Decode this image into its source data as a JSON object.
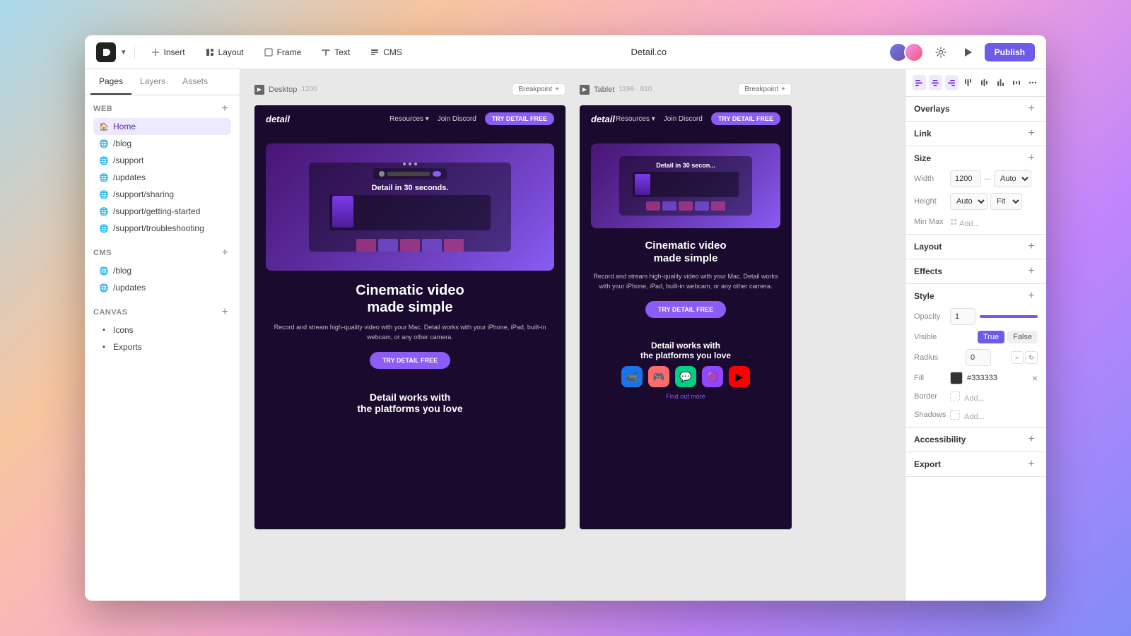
{
  "window": {
    "title": "Detail.co"
  },
  "topbar": {
    "logo": "D",
    "insert_label": "Insert",
    "layout_label": "Layout",
    "frame_label": "Frame",
    "text_label": "Text",
    "cms_label": "CMS",
    "title": "Detail.co",
    "publish_label": "Publish"
  },
  "sidebar": {
    "tabs": [
      "Pages",
      "Layers",
      "Assets"
    ],
    "active_tab": "Pages",
    "sections": {
      "web": {
        "title": "Web",
        "items": [
          {
            "label": "Home",
            "icon": "home",
            "active": true
          },
          {
            "label": "/blog",
            "icon": "globe"
          },
          {
            "label": "/support",
            "icon": "globe"
          },
          {
            "label": "/updates",
            "icon": "globe"
          },
          {
            "label": "/support/sharing",
            "icon": "globe"
          },
          {
            "label": "/support/getting-started",
            "icon": "globe"
          },
          {
            "label": "/support/troubleshooting",
            "icon": "globe"
          }
        ]
      },
      "cms": {
        "title": "CMS",
        "items": [
          {
            "label": "/blog",
            "icon": "globe"
          },
          {
            "label": "/updates",
            "icon": "globe"
          }
        ]
      },
      "canvas": {
        "title": "Canvas",
        "items": [
          {
            "label": "Icons",
            "icon": "canvas"
          },
          {
            "label": "Exports",
            "icon": "canvas"
          }
        ]
      }
    }
  },
  "canvas": {
    "frames": [
      {
        "id": "desktop",
        "label": "Desktop",
        "width": "1200",
        "breakpoint_label": "Breakpoint",
        "headline_line1": "Cinematic video",
        "headline_line2": "made simple",
        "subtext": "Record and stream high-quality video with your Mac. Detail works with your iPhone, iPad, built-in webcam, or any other camera.",
        "cta_label": "TRY DETAIL FREE",
        "platforms_title": "Detail works with\nthe platforms you love",
        "video_title": "Detail in 30 seconds."
      },
      {
        "id": "tablet",
        "label": "Tablet",
        "width": "1199 · 810",
        "breakpoint_label": "Breakpoint",
        "headline_line1": "Cinematic video",
        "headline_line2": "made simple",
        "subtext": "Record and stream high-quality video with your Mac. Detail works with your iPhone, iPad, built-in webcam, or any other camera.",
        "cta_label": "TRY DETAIL FREE",
        "platforms_title": "Detail works with\nthe platforms you love",
        "find_out_more": "Find out more",
        "video_title": "Detail in 30 secon..."
      }
    ]
  },
  "right_panel": {
    "align_icons": [
      "align-left-icon",
      "align-center-icon",
      "align-right-icon",
      "align-top-icon",
      "align-middle-icon",
      "align-bottom-icon",
      "distribute-h-icon",
      "more-icon"
    ],
    "sections": {
      "overlays": {
        "title": "Overlays"
      },
      "link": {
        "title": "Link"
      },
      "size": {
        "title": "Size",
        "width_label": "Width",
        "width_value": "1200",
        "width_unit": "Auto",
        "height_label": "Height",
        "height_value": "Auto",
        "height_unit": "Fit",
        "minmax_label": "Min Max",
        "minmax_placeholder": "Add..."
      },
      "layout": {
        "title": "Layout"
      },
      "effects": {
        "title": "Effects"
      },
      "style": {
        "title": "Style",
        "opacity_label": "Opacity",
        "opacity_value": "1",
        "visible_label": "Visible",
        "true_label": "True",
        "false_label": "False",
        "radius_label": "Radius",
        "radius_value": "0",
        "fill_label": "Fill",
        "fill_color": "#333333",
        "border_label": "Border",
        "border_placeholder": "Add...",
        "shadows_label": "Shadows",
        "shadows_placeholder": "Add..."
      },
      "accessibility": {
        "title": "Accessibility"
      },
      "export": {
        "title": "Export"
      }
    }
  }
}
